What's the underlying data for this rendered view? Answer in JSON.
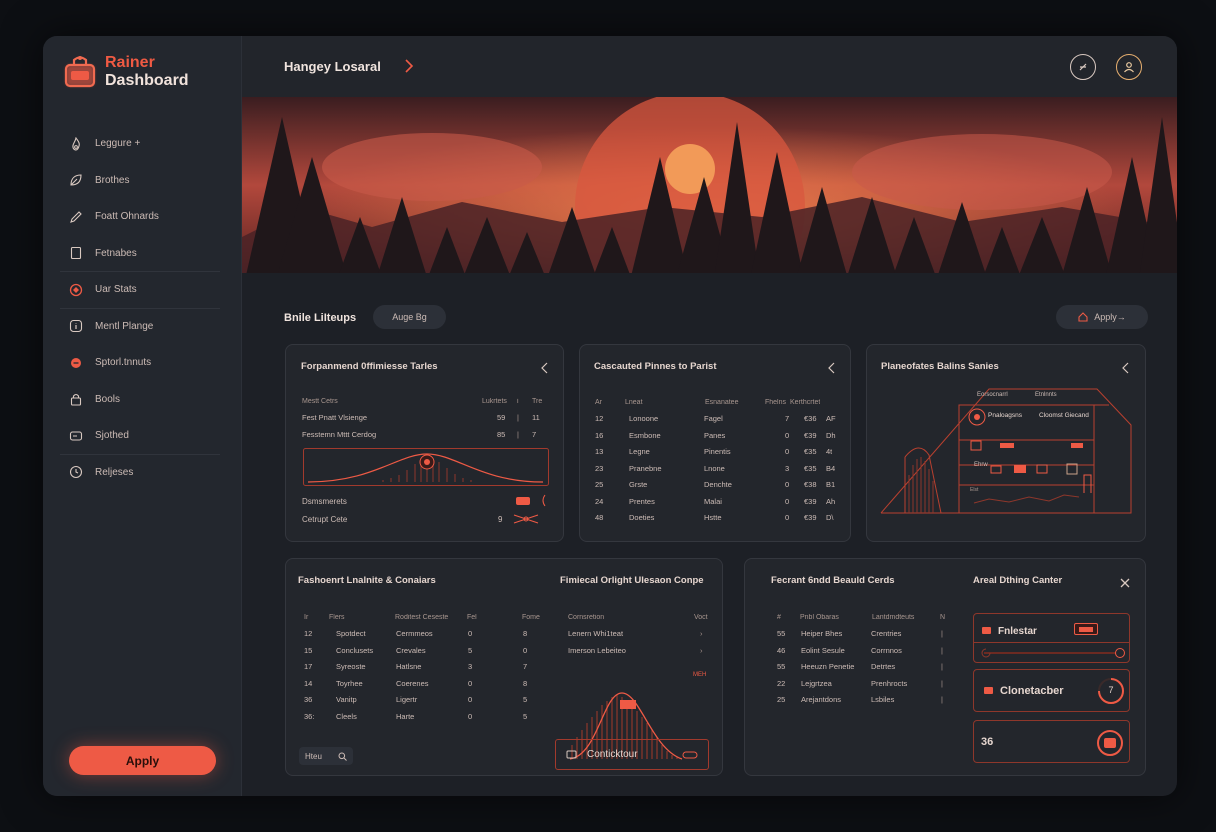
{
  "brand": {
    "line1": "Rainer",
    "line2": "Dashboard"
  },
  "sidebar": {
    "items": [
      {
        "label": "Leggure +",
        "icon": "flame-icon"
      },
      {
        "label": "Brothes",
        "icon": "leaf-icon"
      },
      {
        "label": "Foatt Ohnards",
        "icon": "pencil-icon"
      },
      {
        "label": "Fetnabes",
        "icon": "document-icon"
      },
      {
        "label": "Uar Stats",
        "icon": "target-icon"
      },
      {
        "label": "Mentl Plange",
        "icon": "info-icon"
      },
      {
        "label": "Sptorl.tnnuts",
        "icon": "badge-icon"
      },
      {
        "label": "Bools",
        "icon": "lock-icon"
      },
      {
        "label": "Sjothed",
        "icon": "card-icon"
      },
      {
        "label": "Reljeses",
        "icon": "clock-icon"
      }
    ],
    "apply_label": "Apply"
  },
  "header": {
    "title": "Hangey Losaral"
  },
  "section": {
    "title": "Bnile LiIteups",
    "chip": "Auge Bg",
    "apply": "Apply→"
  },
  "card1": {
    "title": "Forpanmend 0ffimiesse Tarles",
    "headers": [
      "Mestt Cetrs",
      "Lukrtets",
      "i",
      "Tre"
    ],
    "rows": [
      [
        "Fest Pnatt Vlsienge",
        "59",
        "|",
        "11"
      ],
      [
        "Fesstemn Mttt Cerdog",
        "85",
        "|",
        "7"
      ]
    ],
    "footer": [
      {
        "label": "Dsmsmerets"
      },
      {
        "label": "Cetrupt Cete",
        "value": "9"
      }
    ]
  },
  "card2": {
    "title": "Cascauted Pinnes to Parist",
    "headers": [
      "Ar",
      "Lneat",
      "Esnanatee",
      "Fhelns",
      "Kerthcrtet"
    ],
    "rows": [
      [
        "12",
        "Lonoone",
        "Fagel",
        "7",
        "€36",
        "AF"
      ],
      [
        "16",
        "Esmbone",
        "Panes",
        "0",
        "€39",
        "Dh"
      ],
      [
        "13",
        "Legne",
        "Pinentis",
        "0",
        "€35",
        "4t"
      ],
      [
        "23",
        "Pranebne",
        "Lnone",
        "3",
        "€35",
        "B4"
      ],
      [
        "25",
        "Grste",
        "Denchte",
        "0",
        "€38",
        "B1"
      ],
      [
        "24",
        "Prentes",
        "Malai",
        "0",
        "€39",
        "Ah"
      ],
      [
        "48",
        "Doeties",
        "Hstte",
        "0",
        "€39",
        "D\\"
      ]
    ]
  },
  "card3": {
    "title": "Planeofates Balins Sanies",
    "diagram": {
      "top_left": "Eorsocnarrl",
      "top_right": "Etnlnnts",
      "r1_left": "Pnaloagsns",
      "r1_right": "Cloomst Giecand",
      "r3_left": "Ehrw",
      "r4_left": "Elst"
    }
  },
  "card4": {
    "title": "Fashoenrt Lnalnite & Conaiars",
    "title2": "Fimiecal Orlight Ulesaon Conpe",
    "headers": [
      "Ir",
      "Flers",
      "Roditest Ceseste",
      "Fel",
      "Fome"
    ],
    "rows": [
      [
        "12",
        "Spotdect",
        "Cermmeos",
        "0",
        "8"
      ],
      [
        "15",
        "Conclusets",
        "Crevales",
        "5",
        "0"
      ],
      [
        "17",
        "Syreoste",
        "Hatlsne",
        "3",
        "7"
      ],
      [
        "14",
        "Toyrhee",
        "Coerenes",
        "0",
        "8"
      ],
      [
        "36",
        "Vanitp",
        "Ligertr",
        "0",
        "5"
      ],
      [
        "36:",
        "Cleels",
        "Harte",
        "0",
        "5"
      ]
    ],
    "side_headers": [
      "Cornsretion",
      "Voct"
    ],
    "side_rows": [
      "Lenern Whi1teat",
      "Imerson Lebeiteo"
    ],
    "side_tag": "MEH",
    "search_placeholder": "Hteu",
    "bottom_btn": "Conticktour"
  },
  "card5": {
    "title": "Fecrant 6ndd Beauld Cerds",
    "title2": "Areal Dthing Canter",
    "headers": [
      "#",
      "Pnbl Obaras",
      "Lantdmdteuts",
      "N"
    ],
    "rows": [
      [
        "55",
        "Heiper Bhes",
        "Crentries",
        "|"
      ],
      [
        "46",
        "Eolint Sesule",
        "Corrnnos",
        "|"
      ],
      [
        "55",
        "Heeuzn Penetie",
        "Detrtes",
        "|"
      ],
      [
        "22",
        "Lejgrtzea",
        "Prenhrocts",
        "|"
      ],
      [
        "25",
        "Arejantdons",
        "Lsbiles",
        "|"
      ]
    ],
    "w1": "Fnlestar",
    "w2": "Clonetacber",
    "w2_value": "7",
    "w3": "36"
  },
  "colors": {
    "accent": "#ee5a45",
    "bg": "#1d2026",
    "sidebar": "#23272e"
  }
}
